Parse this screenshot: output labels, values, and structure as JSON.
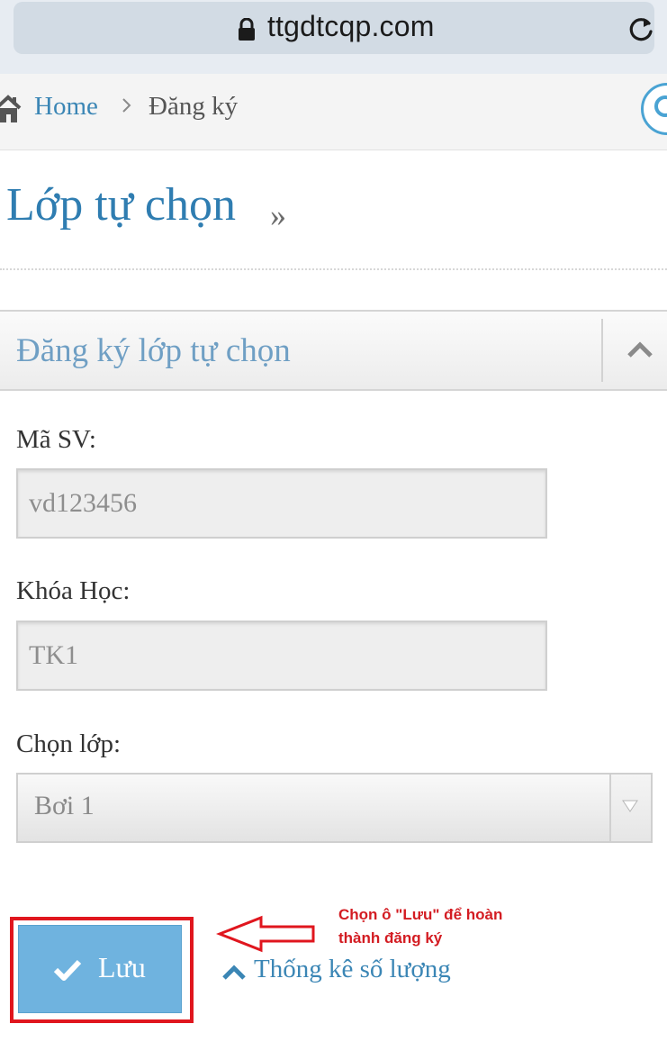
{
  "browser": {
    "url": "ttgdtcqp.com"
  },
  "breadcrumb": {
    "home": "Home",
    "current": "Đăng ký"
  },
  "page": {
    "title": "Lớp tự chọn",
    "title_suffix": "»"
  },
  "panel": {
    "title": "Đăng ký lớp tự chọn"
  },
  "form": {
    "student_id": {
      "label": "Mã SV:",
      "value": "vd123456"
    },
    "course": {
      "label": "Khóa Học:",
      "value": "TK1"
    },
    "class_select": {
      "label": "Chọn lớp:",
      "selected": "Bơi 1"
    }
  },
  "actions": {
    "save_label": "Lưu",
    "stats_link": "Thống kê số lượng"
  },
  "annotation": {
    "line1": "Chọn ô \"Lưu\" để hoàn",
    "line2": "thành đăng ký",
    "color": "#e0161e"
  },
  "colors": {
    "link": "#3b86b5",
    "title": "#2f7db1",
    "save_button": "#6fb3df"
  },
  "icons": [
    "lock-icon",
    "reload-icon",
    "home-icon",
    "chevron-right-icon",
    "search-icon",
    "chevron-up-icon",
    "caret-down-icon",
    "check-icon",
    "arrow-left-icon"
  ]
}
